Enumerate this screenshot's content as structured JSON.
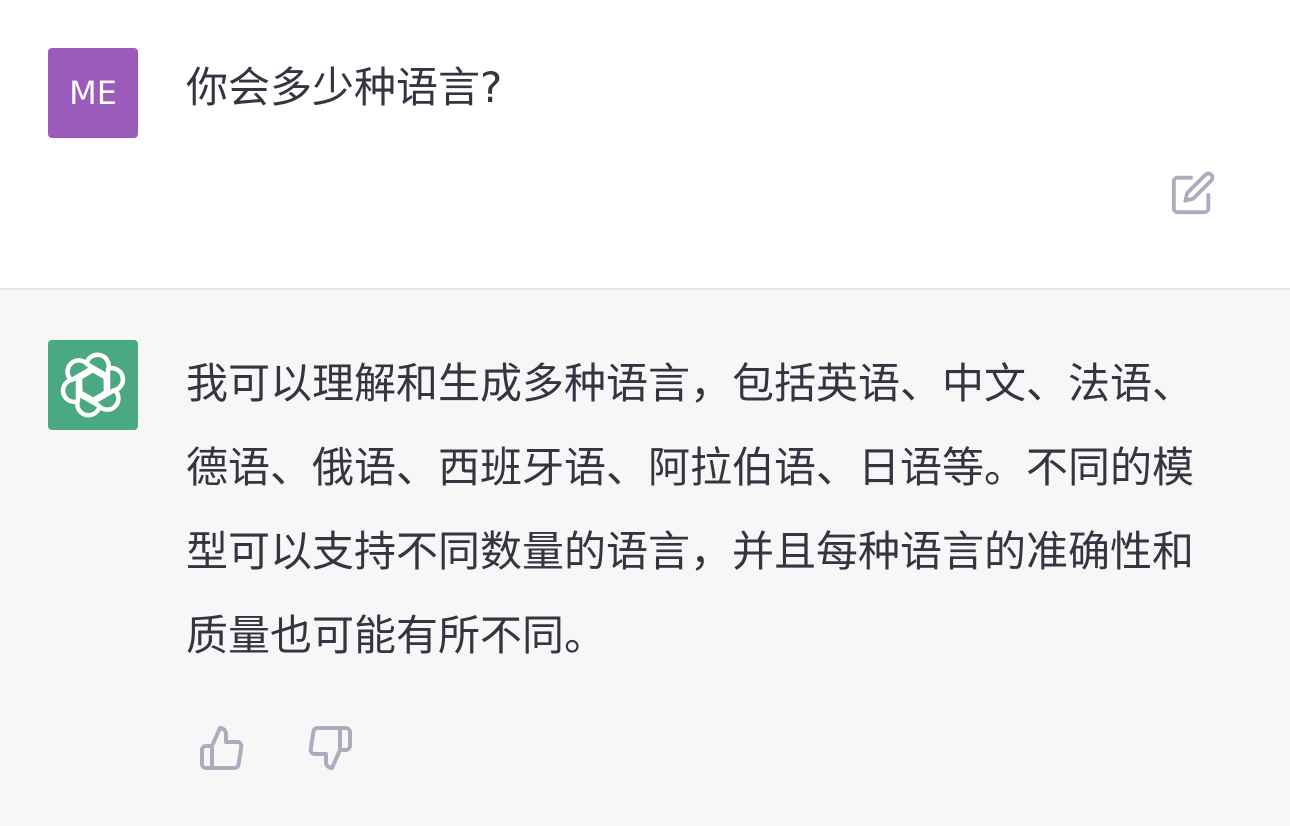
{
  "user": {
    "avatar_initials": "ME",
    "avatar_color": "#9a5bbb",
    "message": "你会多少种语言?"
  },
  "assistant": {
    "avatar_icon": "openai-logo-icon",
    "avatar_color": "#4aa882",
    "message": "我可以理解和生成多种语言，包括英语、中文、法语、德语、俄语、西班牙语、阿拉伯语、日语等。不同的模型可以支持不同数量的语言，并且每种语言的准确性和质量也可能有所不同。"
  },
  "actions": {
    "edit_icon": "edit-icon",
    "thumbs_up_icon": "thumbs-up-icon",
    "thumbs_down_icon": "thumbs-down-icon"
  },
  "colors": {
    "assistant_background": "#f7f7f8",
    "text": "#343541",
    "icon": "#acacbe"
  }
}
